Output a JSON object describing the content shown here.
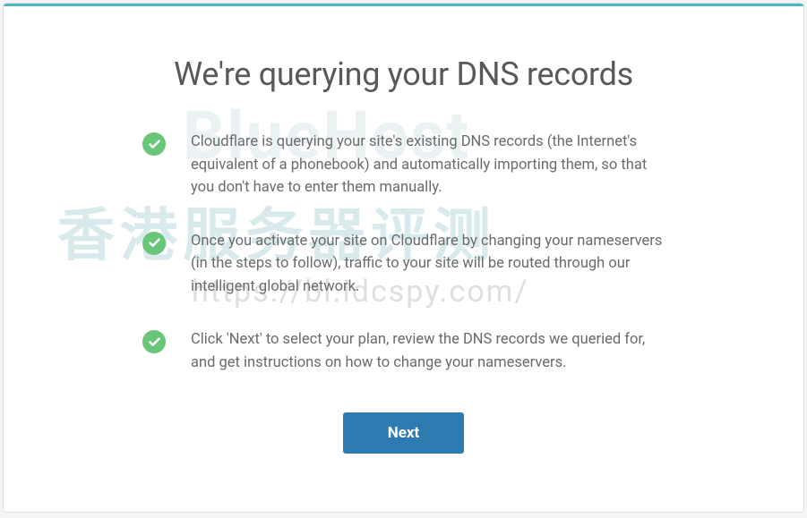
{
  "title": "We're querying your DNS records",
  "items": [
    {
      "text": "Cloudflare is querying your site's existing DNS records (the Internet's equivalent of a phonebook) and automatically importing them, so that you don't have to enter them manually."
    },
    {
      "text": "Once you activate your site on Cloudflare by changing your nameservers (in the steps to follow), traffic to your site will be routed through our intelligent global network."
    },
    {
      "text": "Click 'Next' to select your plan, review the DNS records we queried for, and get instructions on how to change your nameservers."
    }
  ],
  "next_button_label": "Next",
  "watermark": {
    "brand": "BlueHost",
    "text_cn": "香港服务器评测",
    "url": "https://bl.idcspy.com/"
  }
}
